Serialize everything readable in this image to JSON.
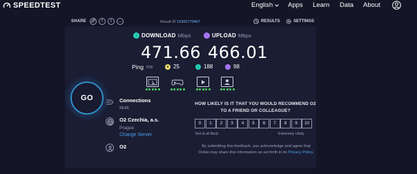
{
  "nav": {
    "logo": "SPEEDTEST",
    "language": "English",
    "apps": "Apps",
    "learn": "Learn",
    "data": "Data",
    "about": "About"
  },
  "share": {
    "label": "SHARE",
    "result_id_label": "Result ID",
    "result_id": "16360770467",
    "results": "RESULTS",
    "settings": "SETTINGS"
  },
  "download": {
    "label": "DOWNLOAD",
    "unit": "Mbps",
    "value": "471.66"
  },
  "upload": {
    "label": "UPLOAD",
    "unit": "Mbps",
    "value": "466.01"
  },
  "ping": {
    "label": "Ping",
    "unit": "ms",
    "idle": "25",
    "download": "188",
    "upload": "98"
  },
  "quality": [
    {
      "name": "browsing",
      "icon": "web-browsing-icon",
      "rating": 5
    },
    {
      "name": "gaming",
      "icon": "gamepad-icon",
      "rating": 5
    },
    {
      "name": "streaming",
      "icon": "video-streaming-icon",
      "rating": 5
    },
    {
      "name": "video-calls",
      "icon": "video-call-icon",
      "rating": 5
    }
  ],
  "go_label": "GO",
  "connections": {
    "title": "Connections",
    "value": "Multi"
  },
  "server": {
    "title": "O2 Czechia, a.s.",
    "location": "Prague",
    "change": "Change Server"
  },
  "isp": {
    "title": "O2"
  },
  "survey": {
    "question": "HOW LIKELY IS IT THAT YOU WOULD RECOMMEND O2 TO A FRIEND OR COLLEAGUE?",
    "scale": [
      "0",
      "1",
      "2",
      "3",
      "4",
      "5",
      "6",
      "7",
      "8",
      "9",
      "10"
    ],
    "low_label": "Not at all likely",
    "high_label": "Extremely Likely",
    "note": "By submitting this feedback, you acknowledge and agree that Ookla may share this information as set forth in its",
    "privacy": "Privacy Policy."
  },
  "colors": {
    "background": "#141526",
    "card": "#1b1d33",
    "download": "#26d0b8",
    "upload": "#a978ff",
    "link": "#4aa3f0"
  }
}
